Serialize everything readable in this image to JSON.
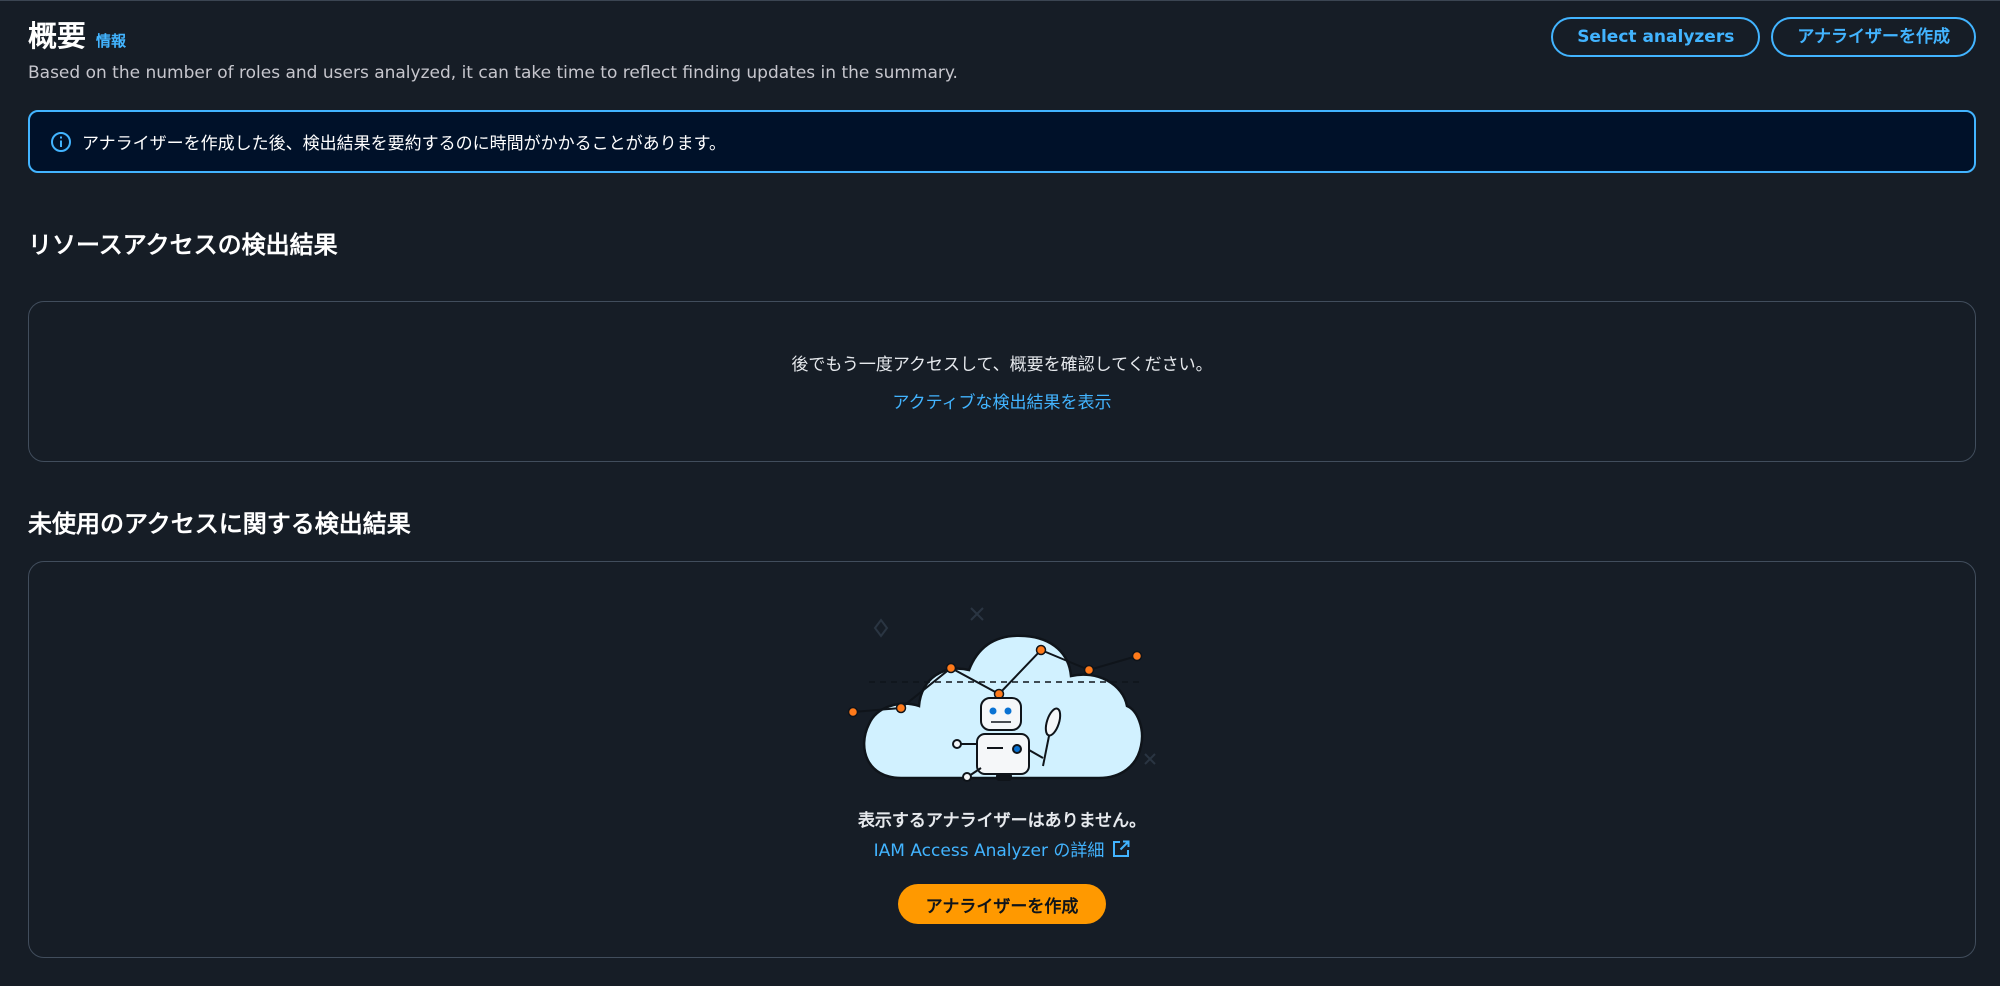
{
  "header": {
    "title": "概要",
    "info_link": "情報",
    "subtitle": "Based on the number of roles and users analyzed, it can take time to reflect finding updates in the summary.",
    "select_analyzers_label": "Select analyzers",
    "create_analyzer_label": "アナライザーを作成"
  },
  "alert": {
    "icon": "info-icon",
    "text": "アナライザーを作成した後、検出結果を要約するのに時間がかかることがあります。"
  },
  "resource_access": {
    "heading": "リソースアクセスの検出結果",
    "message": "後でもう一度アクセスして、概要を確認してください。",
    "link_label": "アクティブな検出結果を表示"
  },
  "unused_access": {
    "heading": "未使用のアクセスに関する検出結果",
    "illustration": "robot-cloud-chart-illustration",
    "empty_title": "表示するアナライザーはありません。",
    "learn_more_label": "IAM Access Analyzer の詳細",
    "learn_more_icon": "external-link-icon",
    "create_button_label": "アナライザーを作成"
  },
  "colors": {
    "background": "#161d26",
    "accent_blue": "#42b4ff",
    "primary_orange": "#ff9900",
    "alert_background": "#001129",
    "card_border": "#414d5c"
  }
}
